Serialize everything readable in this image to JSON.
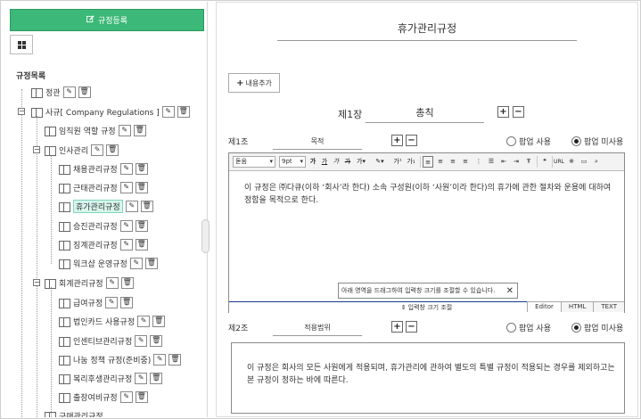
{
  "left": {
    "register_button": "규정등록",
    "tree_title": "규정목록",
    "nodes": [
      {
        "label": "정관"
      },
      {
        "label": "사규[ Company Regulations ]"
      },
      {
        "label": "임직원 역할 규정"
      },
      {
        "label": "인사관리"
      },
      {
        "label": "채용관리규정"
      },
      {
        "label": "근태관리규정"
      },
      {
        "label": "휴가관리규정",
        "selected": true
      },
      {
        "label": "승진관리규정"
      },
      {
        "label": "징계관리규정"
      },
      {
        "label": "워크샵 운영규정"
      },
      {
        "label": "회계관리규정"
      },
      {
        "label": "급여규정"
      },
      {
        "label": "법인카드 사용규정"
      },
      {
        "label": "인센티브관리규정"
      },
      {
        "label": "나눔 정책 규정(준비중)"
      },
      {
        "label": "복리후생관리규정"
      },
      {
        "label": "출장여비규정"
      },
      {
        "label": "구매관리규정"
      }
    ]
  },
  "right": {
    "doc_title": "휴가관리규정",
    "add_content_button": "내용추가",
    "chapter": {
      "no": "제1장",
      "name": "총칙"
    },
    "articles": [
      {
        "no": "제1조",
        "name": "목적",
        "popup_use": "팝업 사용",
        "popup_nouse": "팝업 미사용",
        "content": "이 규정은 ㈜다큐(이하 ‘회사’라 한다) 소속 구성원(이하 ‘사원’이라 한다)의 휴가에 관한 절차와 운용에 대하여 정함을 목적으로 한다."
      },
      {
        "no": "제2조",
        "name": "적용범위",
        "popup_use": "팝업 사용",
        "popup_nouse": "팝업 미사용",
        "content": "이 규정은 회사의 모든 사원에게 적용되며, 휴가관리에 관하여 별도의 특별 규정이 적용되는 경우를 제외하고는 본 규정이 정하는 바에 따른다."
      }
    ],
    "editor": {
      "font": "돋움",
      "size": "9pt",
      "tooltip": "아래 영역을 드래그하여 입력창 크기를 조절할 수 있습니다.",
      "resize_label": "입력창 크기 조절",
      "modes": [
        "Editor",
        "HTML",
        "TEXT"
      ],
      "active_mode": "Editor"
    }
  }
}
